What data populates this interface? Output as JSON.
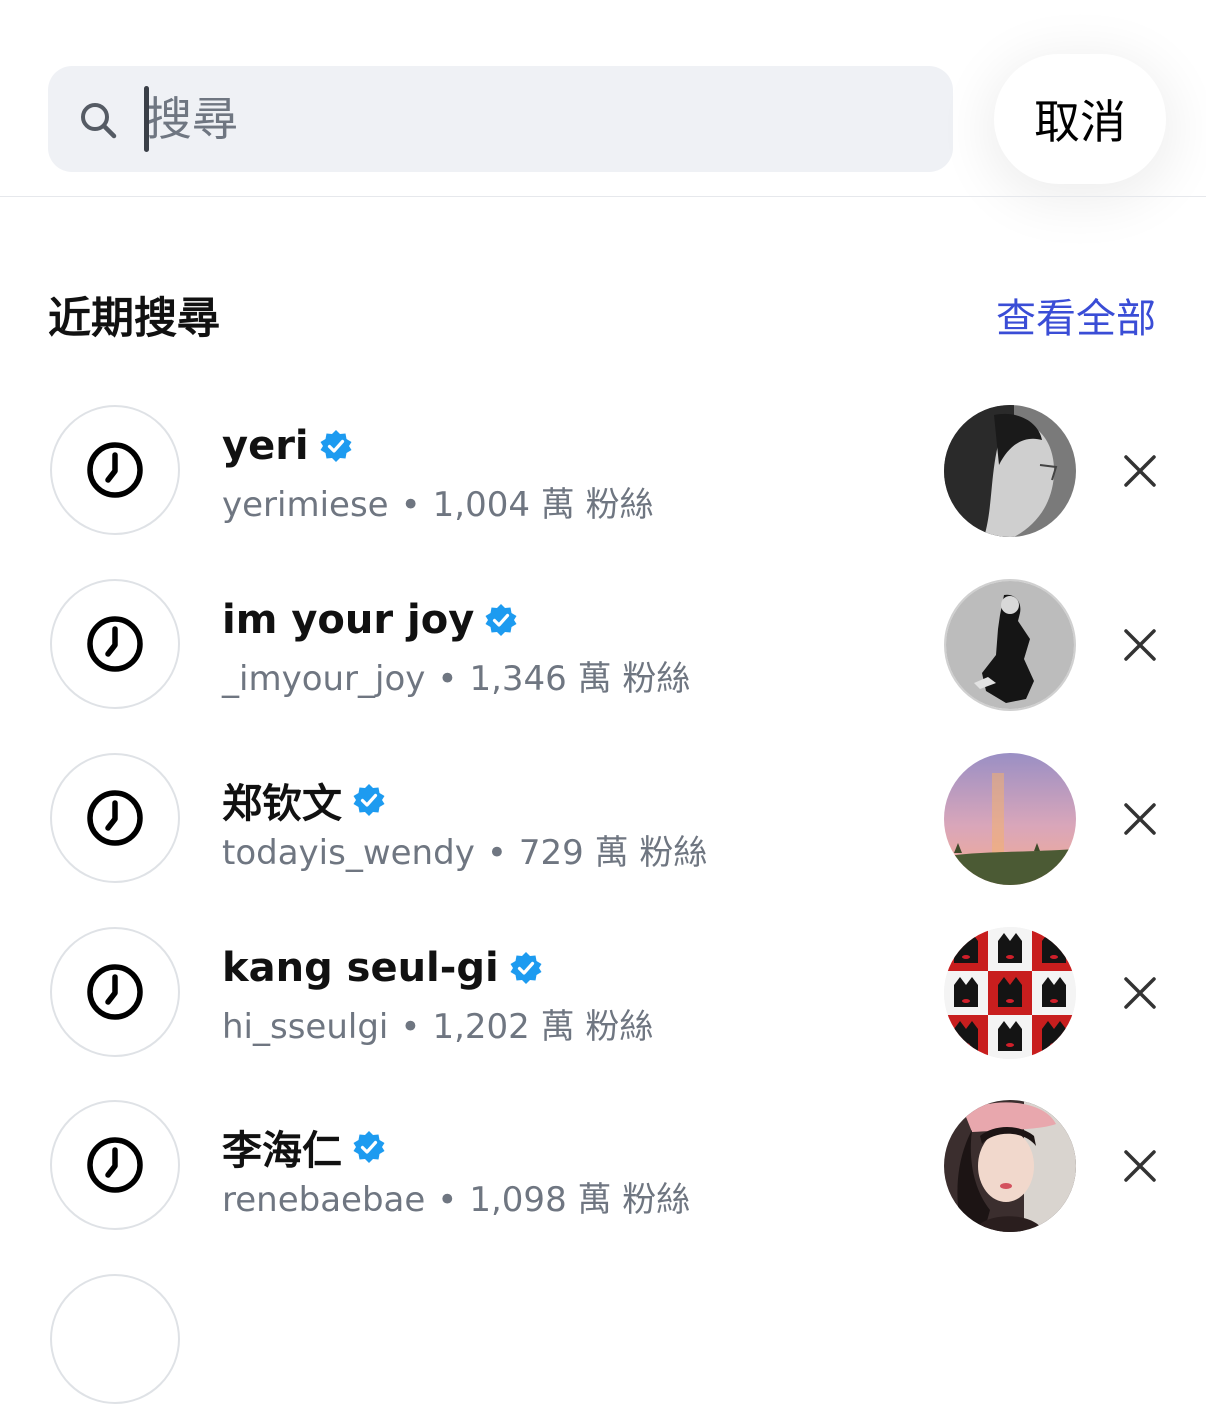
{
  "search": {
    "placeholder": "搜尋",
    "value": ""
  },
  "cancel_label": "取消",
  "recent": {
    "title": "近期搜尋",
    "see_all_label": "查看全部",
    "items": [
      {
        "name": "yeri",
        "username": "yerimiese",
        "followers": "1,004 萬 粉絲",
        "verified": true,
        "avatar": "grayscale-portrait"
      },
      {
        "name": "im your joy",
        "username": "_imyour_joy",
        "followers": "1,346 萬 粉絲",
        "verified": true,
        "avatar": "grayscale-crouching-pose"
      },
      {
        "name": "郑钦文",
        "username": "todayis_wendy",
        "followers": "729 萬 粉絲",
        "verified": true,
        "avatar": "rainbow-sky"
      },
      {
        "name": "kang seul-gi",
        "username": "hi_sseulgi",
        "followers": "1,202 萬 粉絲",
        "verified": true,
        "avatar": "red-black-poster-collage"
      },
      {
        "name": "李海仁",
        "username": "renebaebae",
        "followers": "1,098 萬 粉絲",
        "verified": true,
        "avatar": "pink-beret-selfie"
      }
    ]
  },
  "colors": {
    "accent_link": "#3a4dd6",
    "verified_badge": "#1d9bf0",
    "secondary_text": "#6f7681",
    "search_bg": "#eff1f5"
  }
}
